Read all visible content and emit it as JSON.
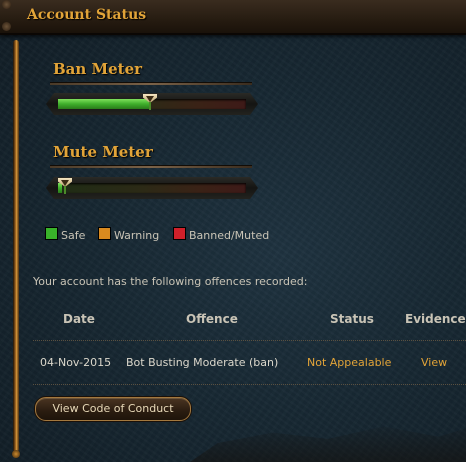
{
  "header": {
    "title": "Account Status"
  },
  "ban_meter": {
    "title": "Ban Meter",
    "level": 0.49
  },
  "mute_meter": {
    "title": "Mute Meter",
    "level": 0.02
  },
  "legend": [
    {
      "label": "Safe",
      "color": "#39b32a"
    },
    {
      "label": "Warning",
      "color": "#d98a1f"
    },
    {
      "label": "Banned/Muted",
      "color": "#d0202a"
    }
  ],
  "offences": {
    "intro": "Your account has the following offences recorded:",
    "headers": {
      "date": "Date",
      "offence": "Offence",
      "status": "Status",
      "evidence": "Evidence"
    },
    "rows": [
      {
        "date": "04-Nov-2015",
        "offence": "Bot Busting Moderate (ban)",
        "status": "Not Appealable",
        "evidence": "View"
      }
    ]
  },
  "code_of_conduct_button": "View Code of Conduct",
  "colors": {
    "accent": "#e2a438",
    "text": "#c9c4b6"
  }
}
